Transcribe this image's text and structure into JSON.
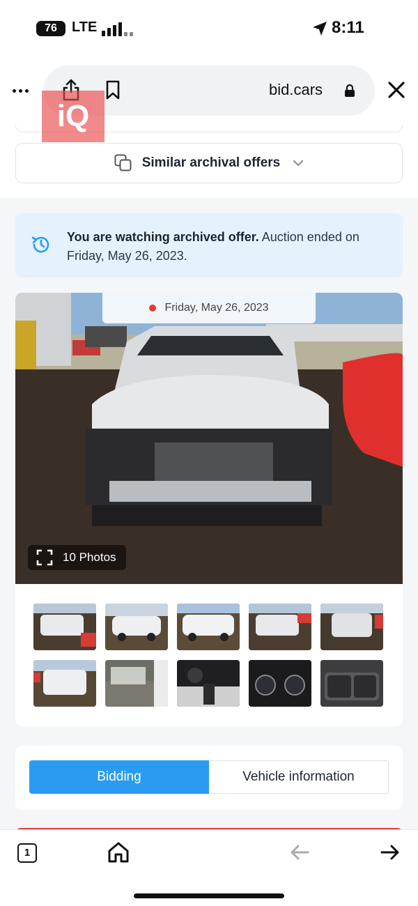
{
  "status_bar": {
    "battery": "76",
    "network": "LTE",
    "time": "8:11"
  },
  "browser": {
    "domain": "bid.cars",
    "watermark_logo": "iQ"
  },
  "similar_offers": {
    "label": "Similar archival offers"
  },
  "archive_notice": {
    "bold": "You are watching archived offer.",
    "text": " Auction ended on Friday, May 26, 2023."
  },
  "gallery": {
    "date": "Friday, May 26, 2023",
    "photos_label": "10 Photos",
    "thumbnails": [
      "front-left",
      "rear-left",
      "right-side",
      "front-right",
      "front",
      "rear",
      "interior-front",
      "dashboard",
      "instrument-cluster",
      "rear-seats"
    ]
  },
  "tabs": {
    "bidding": "Bidding",
    "vehicle_info": "Vehicle information"
  },
  "bottom_bar": {
    "tab_count": "1"
  },
  "colors": {
    "accent": "#2a9bf0",
    "banner_bg": "#e5f1fd",
    "danger": "#e53935"
  }
}
